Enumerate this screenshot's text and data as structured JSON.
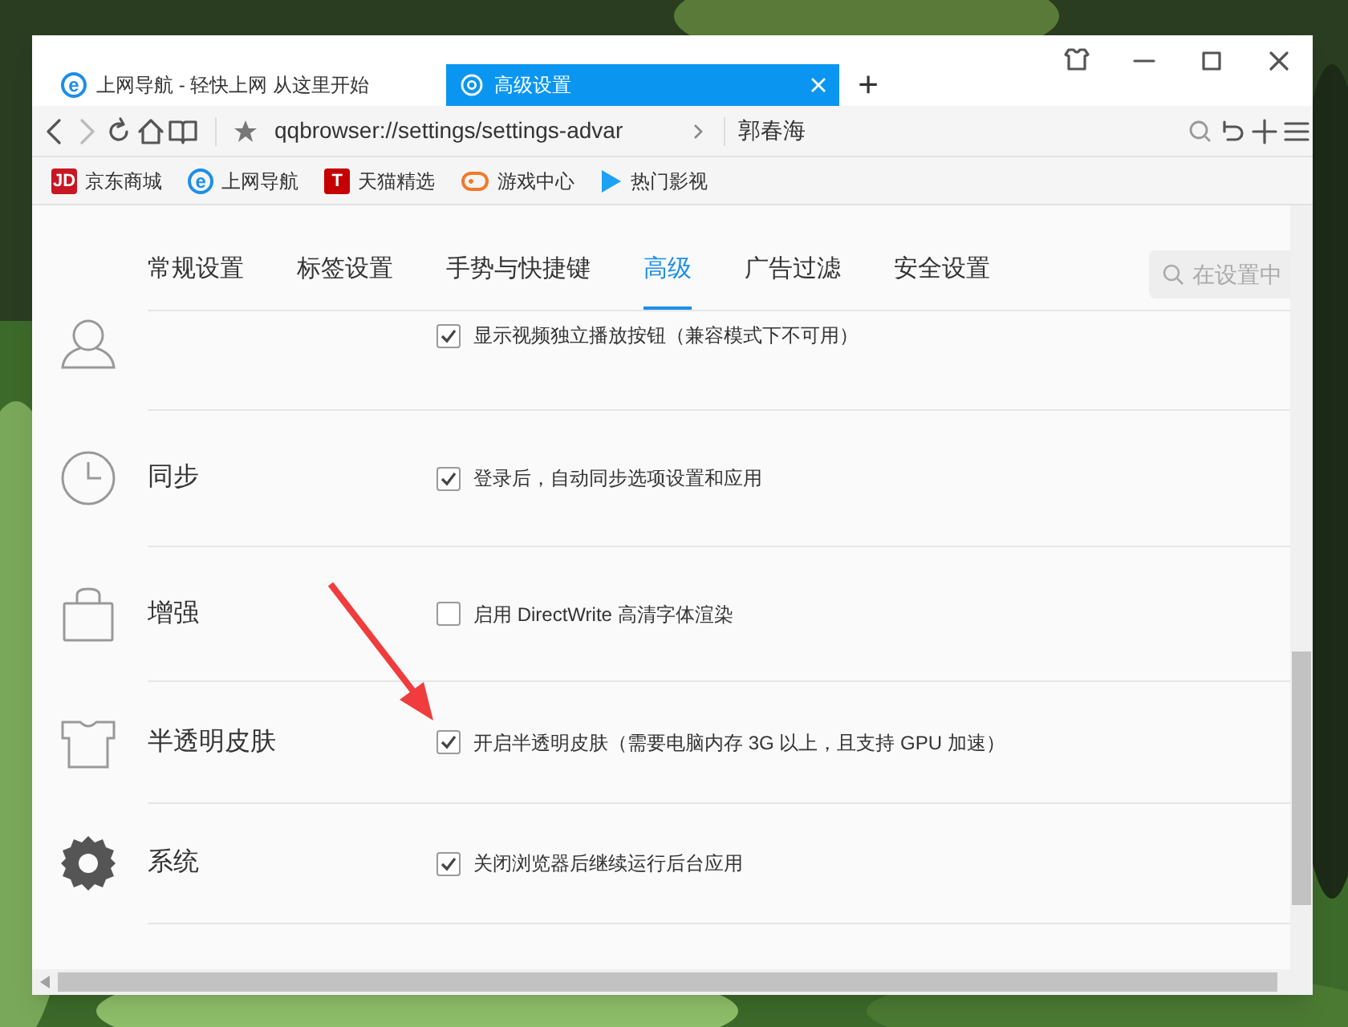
{
  "tabs": [
    {
      "title": "上网导航 - 轻快上网 从这里开始",
      "kind": "ie",
      "icon_text": "e",
      "selected": false
    },
    {
      "title": "高级设置",
      "kind": "settings",
      "selected": true
    }
  ],
  "new_tab": "+",
  "toolbar": {
    "address": "qqbrowser://settings/settings-advar",
    "user": "郭春海"
  },
  "bookmarks": [
    {
      "label": "京东商城",
      "kind": "badge",
      "icon_text": "JD",
      "color": "#c81623"
    },
    {
      "label": "上网导航",
      "kind": "ie",
      "icon_text": "e",
      "color": "#1e8ee8"
    },
    {
      "label": "天猫精选",
      "kind": "badge",
      "icon_text": "T",
      "color": "#c40000"
    },
    {
      "label": "游戏中心",
      "kind": "gamepad",
      "color": "#f07a2a"
    },
    {
      "label": "热门影视",
      "kind": "play",
      "color": "#1da1f2"
    }
  ],
  "settings_tabs": [
    {
      "label": "常规设置",
      "selected": false
    },
    {
      "label": "标签设置",
      "selected": false
    },
    {
      "label": "手势与快捷键",
      "selected": false
    },
    {
      "label": "高级",
      "selected": true
    },
    {
      "label": "广告过滤",
      "selected": false
    },
    {
      "label": "安全设置",
      "selected": false
    }
  ],
  "search": {
    "placeholder": "在设置中"
  },
  "sections": [
    {
      "kind": "user",
      "options": [
        {
          "text": "显示视频独立播放按钮（兼容模式下不可用）",
          "checked": true
        }
      ]
    },
    {
      "kind": "clock",
      "label": "同步",
      "options": [
        {
          "text": "登录后，自动同步选项设置和应用",
          "checked": true
        }
      ]
    },
    {
      "kind": "bag",
      "label": "增强",
      "options": [
        {
          "text": "启用 DirectWrite 高清字体渲染",
          "checked": false
        }
      ]
    },
    {
      "kind": "shirt",
      "label": "半透明皮肤",
      "options": [
        {
          "text": "开启半透明皮肤（需要电脑内存 3G 以上，且支持 GPU 加速）",
          "checked": true
        }
      ]
    },
    {
      "kind": "gear",
      "label": "系统",
      "options": [
        {
          "text": "关闭浏览器后继续运行后台应用",
          "checked": true
        }
      ]
    }
  ]
}
